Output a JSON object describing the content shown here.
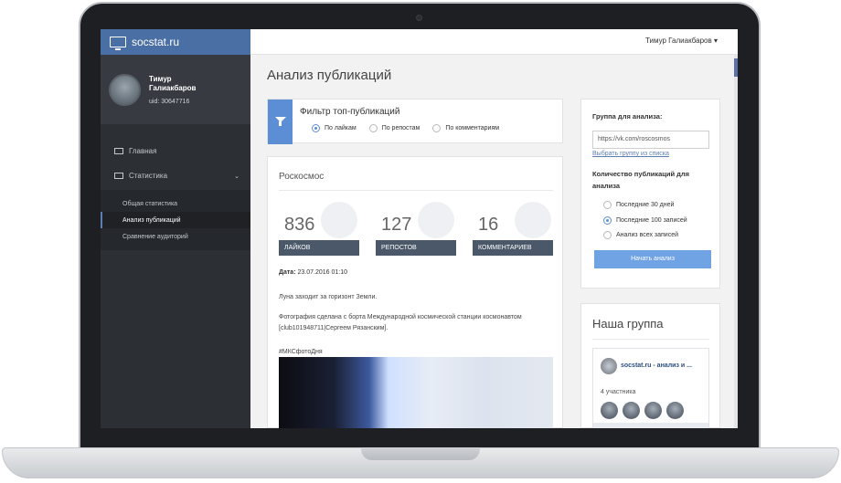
{
  "brand": {
    "name": "socstat.ru"
  },
  "profile": {
    "name": "Тимур Галиакбаров",
    "uid": "uid: 30647716"
  },
  "nav": {
    "home": "Главная",
    "stats": "Статистика",
    "sub": [
      "Общая статистика",
      "Анализ публикаций",
      "Сравнение аудиторий"
    ]
  },
  "topbar": {
    "user": "Тимур Галиакбаров ▾"
  },
  "page": {
    "title": "Анализ публикаций"
  },
  "filter": {
    "title": "Фильтр топ-публикаций",
    "options": [
      "По лайкам",
      "По репостам",
      "По комментариям"
    ],
    "selected": "По лайкам"
  },
  "post": {
    "group": "Роскосмос",
    "stats": [
      {
        "value": "836",
        "label": "ЛАЙКОВ"
      },
      {
        "value": "127",
        "label": "РЕПОСТОВ"
      },
      {
        "value": "16",
        "label": "КОММЕНТАРИЕВ"
      }
    ],
    "date_label": "Дата:",
    "date_value": " 23.07.2016 01:10",
    "text1": "Луна заходит за горизонт Земли.",
    "text2": "Фотография сделана с борта Международной космической станции космонавтом [club101948711|Сергеем Рязанским].",
    "hashtag": "#МКСфотоДня"
  },
  "analysis": {
    "group_label": "Группа для анализа:",
    "group_value": "https://vk.com/roscosmos",
    "choose_link": "Выбрать группу из списка",
    "count_label": "Количество публикаций для анализа",
    "options": [
      "Последние 30 дней",
      "Последние 100 записей",
      "Анализ всех записей"
    ],
    "selected": "Последние 100 записей",
    "button": "Начать анализ"
  },
  "group_widget": {
    "title": "Наша группа",
    "name": "socstat.ru - анализ и ...",
    "members": "4 участника"
  },
  "colors": {
    "brand": "#4a6fa5",
    "accent": "#5b8ed4",
    "button": "#6fa3e3",
    "sidebar": "#2c2f34"
  }
}
